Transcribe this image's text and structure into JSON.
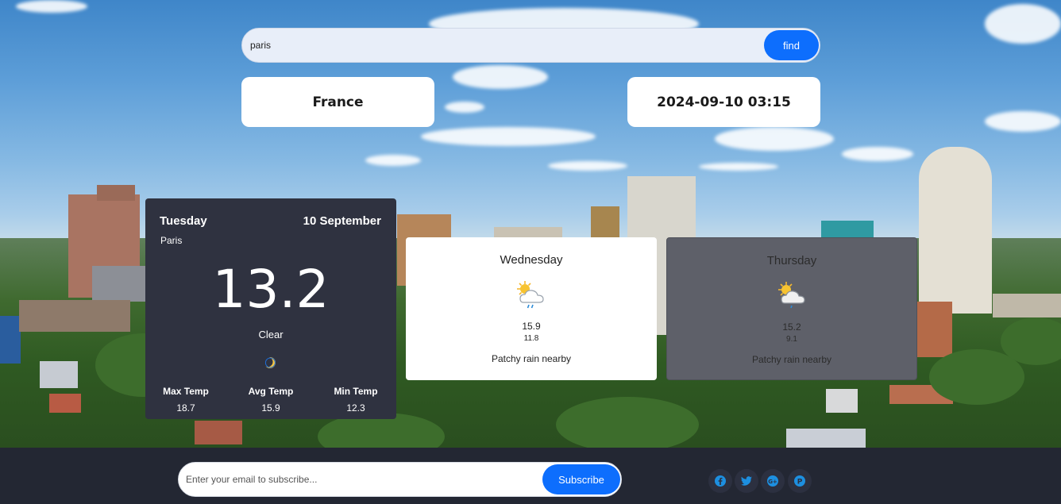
{
  "search": {
    "value": "paris",
    "button_label": "find"
  },
  "location": {
    "country": "France",
    "datetime": "2024-09-10 03:15"
  },
  "today": {
    "day": "Tuesday",
    "date": "10 September",
    "city": "Paris",
    "temperature": "13.2",
    "condition": "Clear",
    "icon": "moon-icon",
    "stats": [
      {
        "label": "Max Temp",
        "value": "18.7"
      },
      {
        "label": "Avg Temp",
        "value": "15.9"
      },
      {
        "label": "Min Temp",
        "value": "12.3"
      }
    ]
  },
  "forecast": [
    {
      "day": "Wednesday",
      "max": "15.9",
      "min": "11.8",
      "condition": "Patchy rain nearby",
      "icon": "patchy-rain-icon"
    },
    {
      "day": "Thursday",
      "max": "15.2",
      "min": "9.1",
      "condition": "Patchy rain nearby",
      "icon": "patchy-rain-icon"
    }
  ],
  "footer": {
    "subscribe_placeholder": "Enter your email to subscribe...",
    "subscribe_button": "Subscribe",
    "social": [
      "facebook-icon",
      "twitter-icon",
      "google-plus-icon",
      "pinterest-icon"
    ]
  },
  "colors": {
    "accent": "#0d6efd",
    "icon_blue": "#2a8bd8",
    "dark_card": "#2f3240",
    "footer": "#232733"
  }
}
